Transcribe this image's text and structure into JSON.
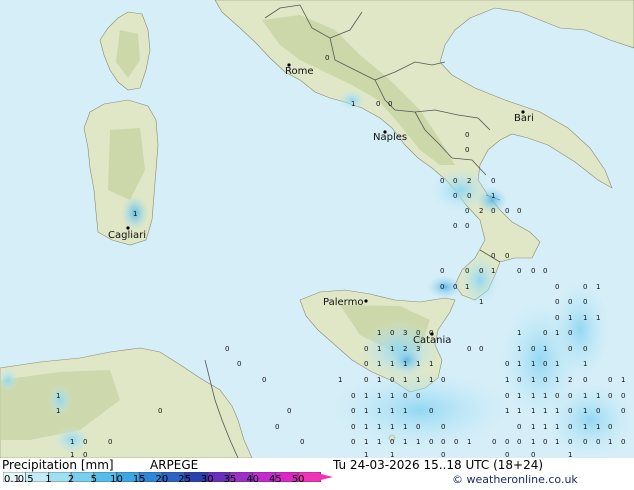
{
  "legend": {
    "title": "Precipitation [mm]",
    "model": "ARPEGE",
    "ticks": [
      {
        "label": "0.1",
        "pos": 0
      },
      {
        "label": "0.5",
        "pos": 1
      },
      {
        "label": "1",
        "pos": 2
      },
      {
        "label": "2",
        "pos": 3
      },
      {
        "label": "5",
        "pos": 4
      },
      {
        "label": "10",
        "pos": 5
      },
      {
        "label": "15",
        "pos": 6
      },
      {
        "label": "20",
        "pos": 7
      },
      {
        "label": "25",
        "pos": 8
      },
      {
        "label": "30",
        "pos": 9
      },
      {
        "label": "35",
        "pos": 10
      },
      {
        "label": "40",
        "pos": 11
      },
      {
        "label": "45",
        "pos": 12
      },
      {
        "label": "50",
        "pos": 13
      }
    ],
    "colors": [
      "#e6f7fb",
      "#c4ecf7",
      "#9fdff2",
      "#78cfee",
      "#55bdea",
      "#3da6e3",
      "#2f86d6",
      "#2b63c4",
      "#2a3fb0",
      "#6a2fbd",
      "#9b2fc7",
      "#c12bcf",
      "#dd26c8",
      "#f032b4"
    ]
  },
  "valid_time": "Tu 24-03-2026 15..18 UTC (18+24)",
  "credit": "© weatheronline.co.uk",
  "cities": {
    "rome": "Rome",
    "naples": "Naples",
    "bari": "Bari",
    "cagliari": "Cagliari",
    "palermo": "Palermo",
    "catania": "Catania"
  },
  "colors": {
    "sea": "#d6eef8",
    "land": "#dfe7c6",
    "highland": "#c7d4a3",
    "border": "#555555",
    "precip_light": "#bfeaf8",
    "precip_mid": "#8fd6f2",
    "precip_strong": "#62bde6"
  }
}
